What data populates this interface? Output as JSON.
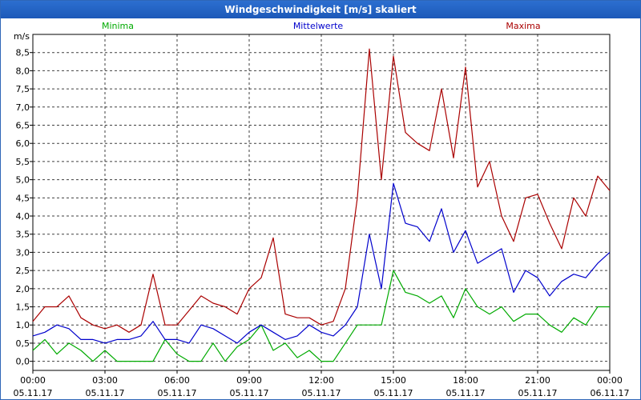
{
  "window": {
    "title": "Windgeschwindigkeit [m/s] skaliert"
  },
  "chart_data": {
    "type": "line",
    "title": "Windgeschwindigkeit [m/s] skaliert",
    "ylabel": "m/s",
    "ylim": [
      -0.25,
      9.0
    ],
    "yticks": [
      0.0,
      0.5,
      1.0,
      1.5,
      2.0,
      2.5,
      3.0,
      3.5,
      4.0,
      4.5,
      5.0,
      5.5,
      6.0,
      6.5,
      7.0,
      7.5,
      8.0,
      8.5
    ],
    "ytick_labels": [
      "0,0",
      "0,5",
      "1,0",
      "1,5",
      "2,0",
      "2,5",
      "3,0",
      "3,5",
      "4,0",
      "4,5",
      "5,0",
      "5,5",
      "6,0",
      "6,5",
      "7,0",
      "7,5",
      "8,0",
      "8,5"
    ],
    "xlim": [
      0,
      24
    ],
    "xticks": [
      0,
      3,
      6,
      9,
      12,
      15,
      18,
      21,
      24
    ],
    "xtick_time_labels": [
      "00:00",
      "03:00",
      "06:00",
      "09:00",
      "12:00",
      "15:00",
      "18:00",
      "21:00",
      "00:00"
    ],
    "xtick_date_labels": [
      "05.11.17",
      "05.11.17",
      "05.11.17",
      "05.11.17",
      "05.11.17",
      "05.11.17",
      "05.11.17",
      "05.11.17",
      "06.11.17"
    ],
    "grid": true,
    "legend_position": "top",
    "series": [
      {
        "name": "Minima",
        "color": "#00aa00",
        "x": [
          0,
          0.5,
          1,
          1.5,
          2,
          2.5,
          3,
          3.5,
          4,
          4.5,
          5,
          5.5,
          6,
          6.5,
          7,
          7.5,
          8,
          8.5,
          9,
          9.5,
          10,
          10.5,
          11,
          11.5,
          12,
          12.5,
          13,
          13.5,
          14,
          14.5,
          15,
          15.5,
          16,
          16.5,
          17,
          17.5,
          18,
          18.5,
          19,
          19.5,
          20,
          20.5,
          21,
          21.5,
          22,
          22.5,
          23,
          23.5,
          24
        ],
        "values": [
          0.3,
          0.6,
          0.2,
          0.5,
          0.3,
          0.0,
          0.3,
          0.0,
          0.0,
          0.0,
          0.0,
          0.6,
          0.2,
          0.0,
          0.0,
          0.5,
          0.0,
          0.4,
          0.6,
          1.0,
          0.3,
          0.5,
          0.1,
          0.3,
          0.0,
          0.0,
          0.5,
          1.0,
          1.0,
          1.0,
          2.5,
          1.9,
          1.8,
          1.6,
          1.8,
          1.2,
          2.0,
          1.5,
          1.3,
          1.5,
          1.1,
          1.3,
          1.3,
          1.0,
          0.8,
          1.2,
          1.0,
          1.5,
          1.5
        ]
      },
      {
        "name": "Mittelwerte",
        "color": "#0000cc",
        "x": [
          0,
          0.5,
          1,
          1.5,
          2,
          2.5,
          3,
          3.5,
          4,
          4.5,
          5,
          5.5,
          6,
          6.5,
          7,
          7.5,
          8,
          8.5,
          9,
          9.5,
          10,
          10.5,
          11,
          11.5,
          12,
          12.5,
          13,
          13.5,
          14,
          14.5,
          15,
          15.5,
          16,
          16.5,
          17,
          17.5,
          18,
          18.5,
          19,
          19.5,
          20,
          20.5,
          21,
          21.5,
          22,
          22.5,
          23,
          23.5,
          24
        ],
        "values": [
          0.7,
          0.8,
          1.0,
          0.9,
          0.6,
          0.6,
          0.5,
          0.6,
          0.6,
          0.7,
          1.1,
          0.6,
          0.6,
          0.5,
          1.0,
          0.9,
          0.7,
          0.5,
          0.8,
          1.0,
          0.8,
          0.6,
          0.7,
          1.0,
          0.8,
          0.7,
          1.0,
          1.5,
          3.5,
          2.0,
          4.9,
          3.8,
          3.7,
          3.3,
          4.2,
          3.0,
          3.6,
          2.7,
          2.9,
          3.1,
          1.9,
          2.5,
          2.3,
          1.8,
          2.2,
          2.4,
          2.3,
          2.7,
          3.0
        ]
      },
      {
        "name": "Maxima",
        "color": "#aa0000",
        "x": [
          0,
          0.5,
          1,
          1.5,
          2,
          2.5,
          3,
          3.5,
          4,
          4.5,
          5,
          5.5,
          6,
          6.5,
          7,
          7.5,
          8,
          8.5,
          9,
          9.5,
          10,
          10.5,
          11,
          11.5,
          12,
          12.5,
          13,
          13.5,
          14,
          14.5,
          15,
          15.5,
          16,
          16.5,
          17,
          17.5,
          18,
          18.5,
          19,
          19.5,
          20,
          20.5,
          21,
          21.5,
          22,
          22.5,
          23,
          23.5,
          24
        ],
        "values": [
          1.1,
          1.5,
          1.5,
          1.8,
          1.2,
          1.0,
          0.9,
          1.0,
          0.8,
          1.0,
          2.4,
          1.0,
          1.0,
          1.4,
          1.8,
          1.6,
          1.5,
          1.3,
          2.0,
          2.3,
          3.4,
          1.3,
          1.2,
          1.2,
          1.0,
          1.1,
          2.0,
          4.5,
          8.6,
          5.0,
          8.4,
          6.3,
          6.0,
          5.8,
          7.5,
          5.6,
          8.1,
          4.8,
          5.5,
          4.0,
          3.3,
          4.5,
          4.6,
          3.8,
          3.1,
          4.5,
          4.0,
          5.1,
          4.7
        ]
      }
    ]
  }
}
